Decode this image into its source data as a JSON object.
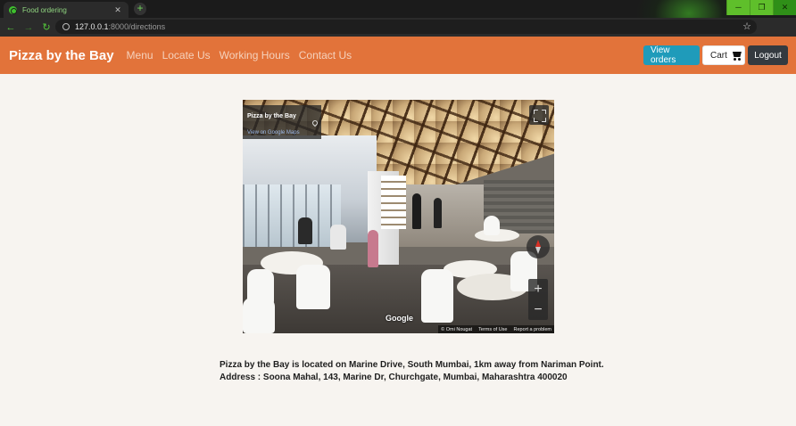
{
  "browser": {
    "tab_title": "Food ordering",
    "tab_close": "✕",
    "new_tab": "+",
    "url_host": "127.0.0.1",
    "url_path": ":8000/directions",
    "win_minimize": "─",
    "win_maximize": "❐",
    "win_close": "✕"
  },
  "navbar": {
    "brand": "Pizza by the Bay",
    "links": [
      "Menu",
      "Locate Us",
      "Working Hours",
      "Contact Us"
    ],
    "view_orders": "View orders",
    "cart": "Cart",
    "logout": "Logout"
  },
  "streetview": {
    "place_name": "Pizza by the Bay",
    "maps_link": "View on Google Maps",
    "zoom_in": "+",
    "zoom_out": "−",
    "logo": "Google",
    "footer": [
      "© Omi Nougat",
      "Terms of Use",
      "Report a problem"
    ]
  },
  "location": {
    "line1": "Pizza by the Bay is located on Marine Drive, South Mumbai, 1km away from Nariman Point.",
    "line2": "Address : Soona Mahal, 143, Marine Dr, Churchgate, Mumbai, Maharashtra 400020"
  },
  "colors": {
    "navbar": "#e2733a",
    "view_orders": "#1f9bba",
    "logout": "#343a40",
    "page_bg": "#f7f4f0"
  }
}
